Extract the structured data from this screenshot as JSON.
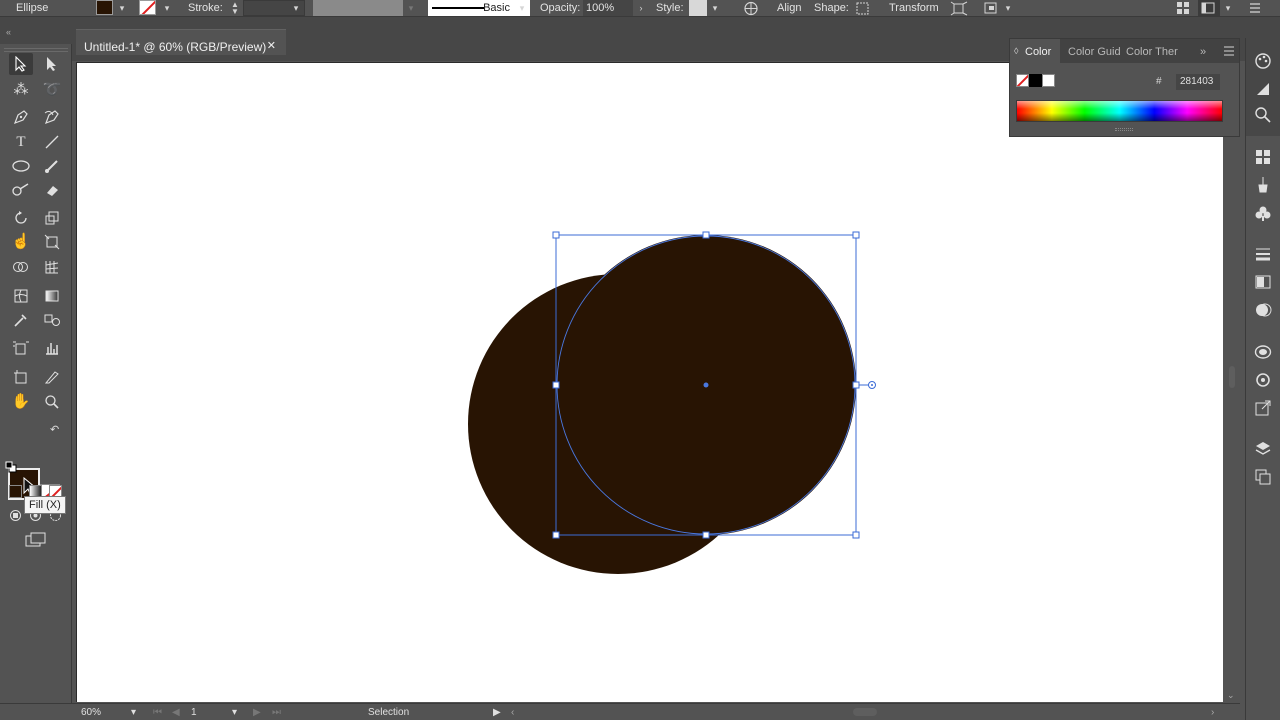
{
  "control_bar": {
    "object_type": "Ellipse",
    "fill_color": "#281403",
    "stroke_label": "Stroke:",
    "stroke_profile": "Basic",
    "opacity_label": "Opacity:",
    "opacity_value": "100%",
    "style_label": "Style:",
    "align_label": "Align",
    "shape_label": "Shape:",
    "transform_label": "Transform"
  },
  "document": {
    "tab_title": "Untitled-1* @ 60% (RGB/Preview)",
    "close_glyph": "✕"
  },
  "toolbar": {
    "fill_tooltip": "Fill (X)",
    "fill_color": "#281403",
    "stroke_color": "none"
  },
  "color_panel": {
    "tabs": [
      "Color",
      "Color Guid",
      "Color Ther"
    ],
    "active_tab": "Color",
    "hex_prefix": "#",
    "hex_value": "281403"
  },
  "status_bar": {
    "zoom": "60%",
    "artboard_number": "1",
    "status_text": "Selection"
  },
  "artwork": {
    "shape_fill": "#281403",
    "selection_color": "#3b6bd6"
  }
}
